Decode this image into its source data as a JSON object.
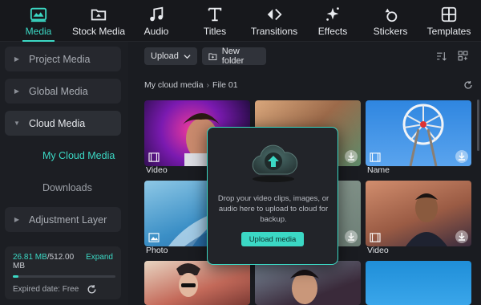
{
  "toolbar": {
    "tabs": [
      {
        "label": "Media",
        "icon": "media-icon",
        "active": true
      },
      {
        "label": "Stock Media",
        "icon": "stock-media-icon"
      },
      {
        "label": "Audio",
        "icon": "music-note-icon"
      },
      {
        "label": "Titles",
        "icon": "text-t-icon"
      },
      {
        "label": "Transitions",
        "icon": "transition-arrows-icon"
      },
      {
        "label": "Effects",
        "icon": "sparkle-icon"
      },
      {
        "label": "Stickers",
        "icon": "sticker-icon"
      },
      {
        "label": "Templates",
        "icon": "templates-grid-icon"
      }
    ]
  },
  "sidebar": {
    "items": [
      {
        "label": "Project Media"
      },
      {
        "label": "Global Media"
      },
      {
        "label": "Cloud Media"
      },
      {
        "label": "Adjustment Layer"
      }
    ],
    "sub_items": [
      {
        "label": "My Cloud Media",
        "active": true
      },
      {
        "label": "Downloads"
      }
    ],
    "storage": {
      "used": "26.81 MB",
      "total": "/512.00 MB",
      "expand_label": "Expand",
      "fill_fraction": 0.052,
      "expired_label": "Expired date: Free"
    }
  },
  "main": {
    "upload_label": "Upload",
    "new_folder_label": "New folder",
    "breadcrumb": [
      "My cloud media",
      "File 01"
    ],
    "cards": [
      {
        "label": "Video",
        "type": "video"
      },
      {
        "label": "",
        "type": "video"
      },
      {
        "label": "Name",
        "type": "video"
      },
      {
        "label": "Photo",
        "type": "photo"
      },
      {
        "label": "",
        "type": "photo"
      },
      {
        "label": "Video",
        "type": "video"
      },
      {
        "label": "",
        "type": "video"
      },
      {
        "label": "",
        "type": "video"
      },
      {
        "label": "",
        "type": "video"
      }
    ]
  },
  "popup": {
    "message": "Drop your video clips, images, or audio here to upload to cloud for backup.",
    "button_label": "Upload media"
  },
  "colors": {
    "accent": "#3bd8c4",
    "background": "#1a1c21",
    "panel": "#26282e"
  }
}
